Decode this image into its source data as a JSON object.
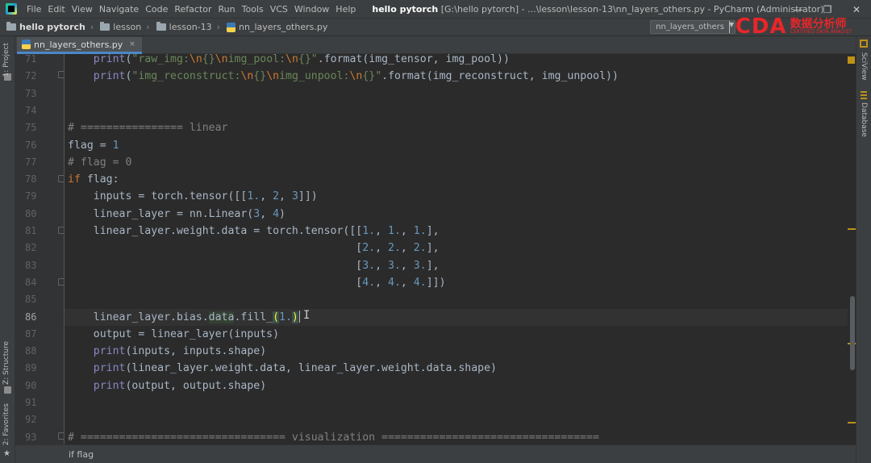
{
  "menubar": {
    "items": [
      "File",
      "Edit",
      "View",
      "Navigate",
      "Code",
      "Refactor",
      "Run",
      "Tools",
      "VCS",
      "Window",
      "Help"
    ],
    "project_name": "hello pytorch",
    "title_rest": " [G:\\hello pytorch] - ...\\lesson\\lesson-13\\nn_layers_others.py - PyCharm (Administrator)",
    "minimize": "—",
    "maximize": "❐",
    "close": "✕"
  },
  "navbar": {
    "crumbs": [
      "hello pytorch",
      "lesson",
      "lesson-13",
      "nn_layers_others.py"
    ],
    "run_config": "nn_layers_others",
    "run_config_caret": "▼"
  },
  "watermark": {
    "brand": "CDA",
    "cn_text": "数据分析师",
    "cn_sub": "CERTIFIED DATA ANALYST"
  },
  "left_tabs": {
    "project": "1: Project",
    "structure": "Z: Structure",
    "favorites": "2: Favorites"
  },
  "right_tabs": {
    "sciview": "SciView",
    "database": "Database"
  },
  "editor": {
    "tab_label": "nn_layers_others.py",
    "tab_close": "×",
    "current_line": 86,
    "line_numbers": [
      "71",
      "72",
      "73",
      "74",
      "75",
      "76",
      "77",
      "78",
      "79",
      "80",
      "81",
      "82",
      "83",
      "84",
      "85",
      "86",
      "87",
      "88",
      "89",
      "90",
      "91",
      "92",
      "93"
    ]
  },
  "footer": {
    "breadcrumb": "if flag"
  },
  "colors": {
    "background": "#2b2b2b",
    "keyword": "#cc7832",
    "string": "#6a8759",
    "number": "#6897bb",
    "comment": "#808080",
    "builtin": "#8888c6",
    "accent": "#4a88c7"
  }
}
